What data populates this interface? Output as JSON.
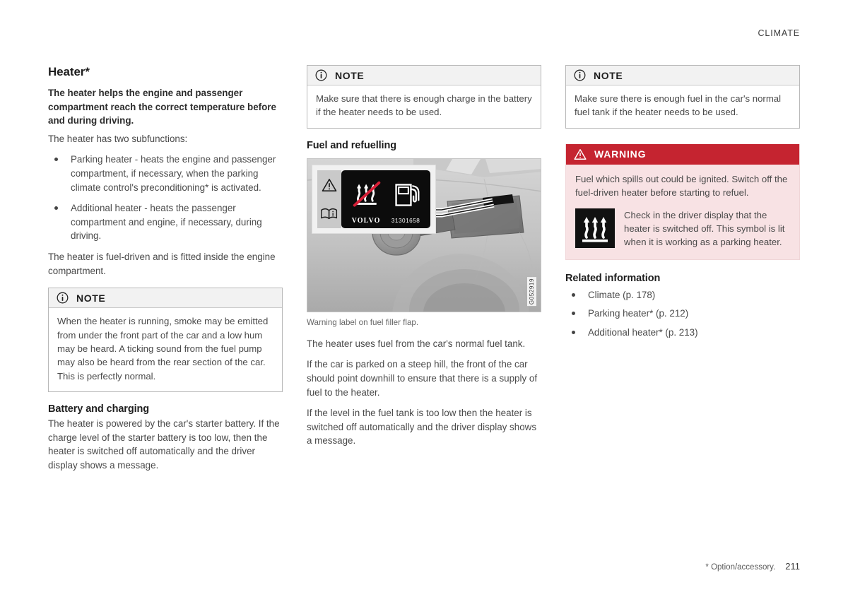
{
  "header": {
    "running_head": "CLIMATE"
  },
  "footer": {
    "option_note": "* Option/accessory.",
    "page_number": "211"
  },
  "column1": {
    "title": "Heater*",
    "lead": "The heater helps the engine and passenger compartment reach the correct temperature before and during driving.",
    "intro": "The heater has two subfunctions:",
    "bullets": [
      "Parking heater - heats the engine and passenger compartment, if necessary, when the parking climate control's preconditioning* is activated.",
      "Additional heater - heats the passenger compartment and engine, if necessary, during driving."
    ],
    "after_bullets": "The heater is fuel-driven and is fitted inside the engine compartment.",
    "note": {
      "icon": "info-circle-icon",
      "label": "NOTE",
      "text": "When the heater is running, smoke may be emitted from under the front part of the car and a low hum may be heard. A ticking sound from the fuel pump may also be heard from the rear section of the car. This is perfectly normal."
    },
    "battery_heading": "Battery and charging",
    "battery_text": "The heater is powered by the car's starter battery. If the charge level of the starter battery is too low, then the heater is switched off automatically and the driver display shows a message."
  },
  "column2": {
    "note": {
      "icon": "info-circle-icon",
      "label": "NOTE",
      "text": "Make sure that there is enough charge in the battery if the heater needs to be used."
    },
    "fuel_heading": "Fuel and refuelling",
    "figure": {
      "caption": "Warning label on fuel filler flap.",
      "image_id": "G052919",
      "label_brand": "VOLVO",
      "label_part_number": "31301658",
      "label_icons": [
        "warning-triangle-icon",
        "manual-book-icon",
        "no-heat-symbol-icon",
        "fuel-pump-icon"
      ]
    },
    "paragraphs": [
      "The heater uses fuel from the car's normal fuel tank.",
      "If the car is parked on a steep hill, the front of the car should point downhill to ensure that there is a supply of fuel to the heater.",
      "If the level in the fuel tank is too low then the heater is switched off automatically and the driver display shows a message."
    ]
  },
  "column3": {
    "note": {
      "icon": "info-circle-icon",
      "label": "NOTE",
      "text": "Make sure there is enough fuel in the car's normal fuel tank if the heater needs to be used."
    },
    "warning": {
      "icon": "warning-triangle-icon",
      "label": "WARNING",
      "text": "Fuel which spills out could be ignited. Switch off the fuel-driven heater before starting to refuel.",
      "symbol_icon": "parking-heater-symbol-icon",
      "symbol_text": "Check in the driver display that the heater is switched off. This symbol is lit when it is working as a parking heater."
    },
    "related_heading": "Related information",
    "related_links": [
      "Climate (p. 178)",
      "Parking heater* (p. 212)",
      "Additional heater* (p. 213)"
    ]
  },
  "colors": {
    "warning_red": "#c52430",
    "warning_body_bg": "#f8e2e4",
    "note_head_bg": "#f2f2f2"
  }
}
